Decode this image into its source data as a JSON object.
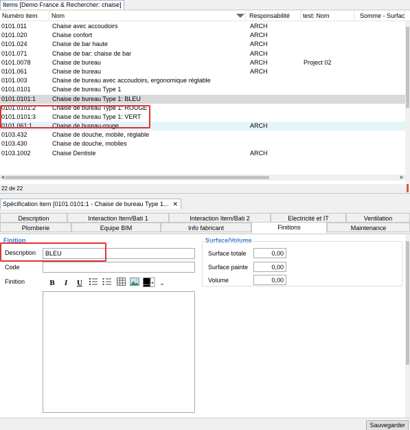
{
  "top_tab": {
    "label": "Items [Demo France & Rechercher: chaise]"
  },
  "grid": {
    "columns": {
      "num": "Numéro item",
      "nom": "Nom",
      "resp": "Responsabilité",
      "test": "test: Nom",
      "somme": "Somme - Surfac"
    },
    "rows": [
      {
        "num": "0101.011",
        "nom": "Chaise avec accoudoirs",
        "resp": "ARCH",
        "test": ""
      },
      {
        "num": "0101.020",
        "nom": "Chaise confort",
        "resp": "ARCH",
        "test": ""
      },
      {
        "num": "0101.024",
        "nom": "Chaise de bar haute",
        "resp": "ARCH",
        "test": ""
      },
      {
        "num": "0101.071",
        "nom": "Chaise de bar: chaise de bar",
        "resp": "ARCH",
        "test": ""
      },
      {
        "num": "0101.0078",
        "nom": "Chaise de bureau",
        "resp": "ARCH",
        "test": "Project 02"
      },
      {
        "num": "0101.061",
        "nom": "Chaise de bureau",
        "resp": "ARCH",
        "test": ""
      },
      {
        "num": "0101.003",
        "nom": "Chaise de bureau avec accoudoirs, ergonomique réglable",
        "resp": "",
        "test": ""
      },
      {
        "num": "0101.0101",
        "nom": "Chaise de bureau Type 1",
        "resp": "",
        "test": ""
      },
      {
        "num": "0101.0101:1",
        "nom": "Chaise de bureau Type 1: BLEU",
        "resp": "",
        "test": ""
      },
      {
        "num": "0101.0101:2",
        "nom": "Chaise de bureau Type 1: ROUGE",
        "resp": "",
        "test": ""
      },
      {
        "num": "0101.0101:3",
        "nom": "Chaise de bureau Type 1: VERT",
        "resp": "",
        "test": ""
      },
      {
        "num": "0101.061:1",
        "nom": "Chaise de bureau-rouge",
        "resp": "ARCH",
        "test": ""
      },
      {
        "num": "0103.432",
        "nom": "Chaise de douche, mobile, réglable",
        "resp": "",
        "test": ""
      },
      {
        "num": "0103.430",
        "nom": "Chaise de douche, mobiles",
        "resp": "",
        "test": ""
      },
      {
        "num": "0103.1002",
        "nom": "Chaise Dentiste",
        "resp": "ARCH",
        "test": ""
      }
    ],
    "selected_index": 8,
    "hover_index": 11,
    "footer_count": "22 de 22"
  },
  "spec": {
    "tab_label": "Spécification item [0101.0101:1 - Chaise de bureau Type 1...",
    "close_glyph": "✕",
    "tabs_row1": [
      "Description",
      "Interaction Item/Bati 1",
      "Interaction Item/Bati 2",
      "Electricité et IT",
      "Ventilation"
    ],
    "tabs_row2": [
      "Plomberie",
      "Equipe BIM",
      "Info fabricant",
      "Finitions",
      "Maintenance"
    ],
    "active_tab": "Finitions",
    "finition": {
      "title": "Finition",
      "description_label": "Description",
      "description_value": "BLEU",
      "code_label": "Code",
      "code_value": "",
      "finition_label": "Finition"
    },
    "surface": {
      "title": "Surface/Volume",
      "totale_label": "Surface totale",
      "totale_value": "0,00",
      "peinte_label": "Surface painte",
      "peinte_value": "0,00",
      "volume_label": "Volume",
      "volume_value": "0,00"
    },
    "toolbar": {
      "bold": "B",
      "italic": "I",
      "underline": "U"
    }
  },
  "save_label": "Sauvegarder",
  "colors": {
    "accent": "#2f7bd8",
    "highlight": "#e03232",
    "selected_row": "#d9d9d9",
    "hover_row": "#e5f3fb"
  }
}
